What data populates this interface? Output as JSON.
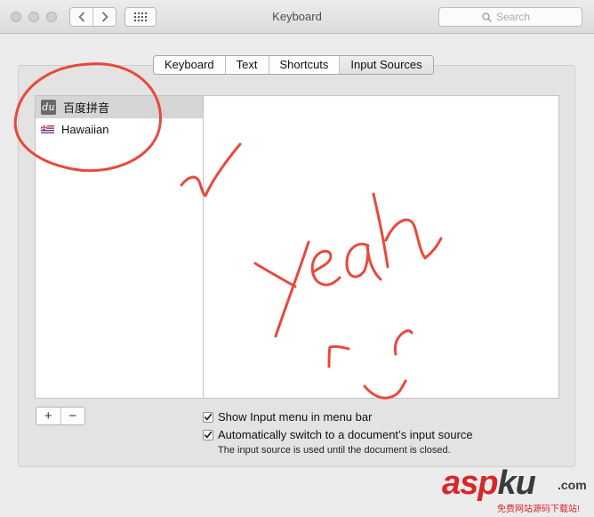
{
  "window": {
    "title": "Keyboard",
    "search_placeholder": "Search"
  },
  "tabs": [
    {
      "label": "Keyboard",
      "active": false
    },
    {
      "label": "Text",
      "active": false
    },
    {
      "label": "Shortcuts",
      "active": false
    },
    {
      "label": "Input Sources",
      "active": true
    }
  ],
  "input_sources": [
    {
      "label": "百度拼音",
      "icon": "baidu-du-icon",
      "selected": true
    },
    {
      "label": "Hawaiian",
      "icon": "hawaii-flag-icon",
      "selected": false
    }
  ],
  "list_buttons": {
    "add": "+",
    "remove": "−"
  },
  "options": {
    "show_menu": {
      "label": "Show Input menu in menu bar",
      "checked": true
    },
    "auto_switch": {
      "label": "Automatically switch to a document’s input source",
      "checked": true
    },
    "note": "The input source is used until the document is closed."
  },
  "watermark": {
    "part1": "asp",
    "part2": "ku",
    "suffix": ".com",
    "subtitle": "免费网站源码下载站!"
  },
  "colors": {
    "annotation": "#e8493c",
    "selection": "#d5d5d5",
    "watermark_red": "#d8262b"
  }
}
